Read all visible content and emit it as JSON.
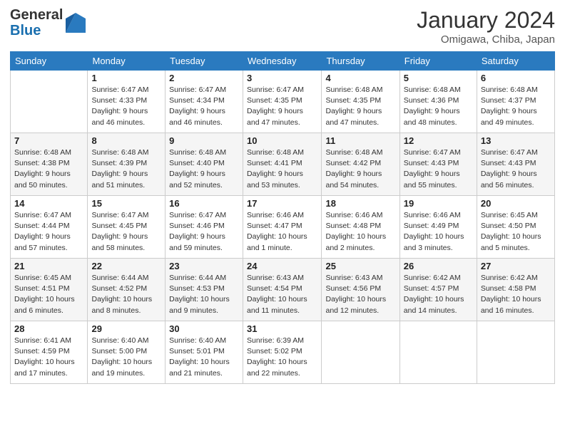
{
  "logo": {
    "general": "General",
    "blue": "Blue"
  },
  "title": {
    "month_year": "January 2024",
    "location": "Omigawa, Chiba, Japan"
  },
  "weekdays": [
    "Sunday",
    "Monday",
    "Tuesday",
    "Wednesday",
    "Thursday",
    "Friday",
    "Saturday"
  ],
  "weeks": [
    [
      {
        "day": "",
        "info": ""
      },
      {
        "day": "1",
        "info": "Sunrise: 6:47 AM\nSunset: 4:33 PM\nDaylight: 9 hours\nand 46 minutes."
      },
      {
        "day": "2",
        "info": "Sunrise: 6:47 AM\nSunset: 4:34 PM\nDaylight: 9 hours\nand 46 minutes."
      },
      {
        "day": "3",
        "info": "Sunrise: 6:47 AM\nSunset: 4:35 PM\nDaylight: 9 hours\nand 47 minutes."
      },
      {
        "day": "4",
        "info": "Sunrise: 6:48 AM\nSunset: 4:35 PM\nDaylight: 9 hours\nand 47 minutes."
      },
      {
        "day": "5",
        "info": "Sunrise: 6:48 AM\nSunset: 4:36 PM\nDaylight: 9 hours\nand 48 minutes."
      },
      {
        "day": "6",
        "info": "Sunrise: 6:48 AM\nSunset: 4:37 PM\nDaylight: 9 hours\nand 49 minutes."
      }
    ],
    [
      {
        "day": "7",
        "info": "Sunrise: 6:48 AM\nSunset: 4:38 PM\nDaylight: 9 hours\nand 50 minutes."
      },
      {
        "day": "8",
        "info": "Sunrise: 6:48 AM\nSunset: 4:39 PM\nDaylight: 9 hours\nand 51 minutes."
      },
      {
        "day": "9",
        "info": "Sunrise: 6:48 AM\nSunset: 4:40 PM\nDaylight: 9 hours\nand 52 minutes."
      },
      {
        "day": "10",
        "info": "Sunrise: 6:48 AM\nSunset: 4:41 PM\nDaylight: 9 hours\nand 53 minutes."
      },
      {
        "day": "11",
        "info": "Sunrise: 6:48 AM\nSunset: 4:42 PM\nDaylight: 9 hours\nand 54 minutes."
      },
      {
        "day": "12",
        "info": "Sunrise: 6:47 AM\nSunset: 4:43 PM\nDaylight: 9 hours\nand 55 minutes."
      },
      {
        "day": "13",
        "info": "Sunrise: 6:47 AM\nSunset: 4:43 PM\nDaylight: 9 hours\nand 56 minutes."
      }
    ],
    [
      {
        "day": "14",
        "info": "Sunrise: 6:47 AM\nSunset: 4:44 PM\nDaylight: 9 hours\nand 57 minutes."
      },
      {
        "day": "15",
        "info": "Sunrise: 6:47 AM\nSunset: 4:45 PM\nDaylight: 9 hours\nand 58 minutes."
      },
      {
        "day": "16",
        "info": "Sunrise: 6:47 AM\nSunset: 4:46 PM\nDaylight: 9 hours\nand 59 minutes."
      },
      {
        "day": "17",
        "info": "Sunrise: 6:46 AM\nSunset: 4:47 PM\nDaylight: 10 hours\nand 1 minute."
      },
      {
        "day": "18",
        "info": "Sunrise: 6:46 AM\nSunset: 4:48 PM\nDaylight: 10 hours\nand 2 minutes."
      },
      {
        "day": "19",
        "info": "Sunrise: 6:46 AM\nSunset: 4:49 PM\nDaylight: 10 hours\nand 3 minutes."
      },
      {
        "day": "20",
        "info": "Sunrise: 6:45 AM\nSunset: 4:50 PM\nDaylight: 10 hours\nand 5 minutes."
      }
    ],
    [
      {
        "day": "21",
        "info": "Sunrise: 6:45 AM\nSunset: 4:51 PM\nDaylight: 10 hours\nand 6 minutes."
      },
      {
        "day": "22",
        "info": "Sunrise: 6:44 AM\nSunset: 4:52 PM\nDaylight: 10 hours\nand 8 minutes."
      },
      {
        "day": "23",
        "info": "Sunrise: 6:44 AM\nSunset: 4:53 PM\nDaylight: 10 hours\nand 9 minutes."
      },
      {
        "day": "24",
        "info": "Sunrise: 6:43 AM\nSunset: 4:54 PM\nDaylight: 10 hours\nand 11 minutes."
      },
      {
        "day": "25",
        "info": "Sunrise: 6:43 AM\nSunset: 4:56 PM\nDaylight: 10 hours\nand 12 minutes."
      },
      {
        "day": "26",
        "info": "Sunrise: 6:42 AM\nSunset: 4:57 PM\nDaylight: 10 hours\nand 14 minutes."
      },
      {
        "day": "27",
        "info": "Sunrise: 6:42 AM\nSunset: 4:58 PM\nDaylight: 10 hours\nand 16 minutes."
      }
    ],
    [
      {
        "day": "28",
        "info": "Sunrise: 6:41 AM\nSunset: 4:59 PM\nDaylight: 10 hours\nand 17 minutes."
      },
      {
        "day": "29",
        "info": "Sunrise: 6:40 AM\nSunset: 5:00 PM\nDaylight: 10 hours\nand 19 minutes."
      },
      {
        "day": "30",
        "info": "Sunrise: 6:40 AM\nSunset: 5:01 PM\nDaylight: 10 hours\nand 21 minutes."
      },
      {
        "day": "31",
        "info": "Sunrise: 6:39 AM\nSunset: 5:02 PM\nDaylight: 10 hours\nand 22 minutes."
      },
      {
        "day": "",
        "info": ""
      },
      {
        "day": "",
        "info": ""
      },
      {
        "day": "",
        "info": ""
      }
    ]
  ]
}
